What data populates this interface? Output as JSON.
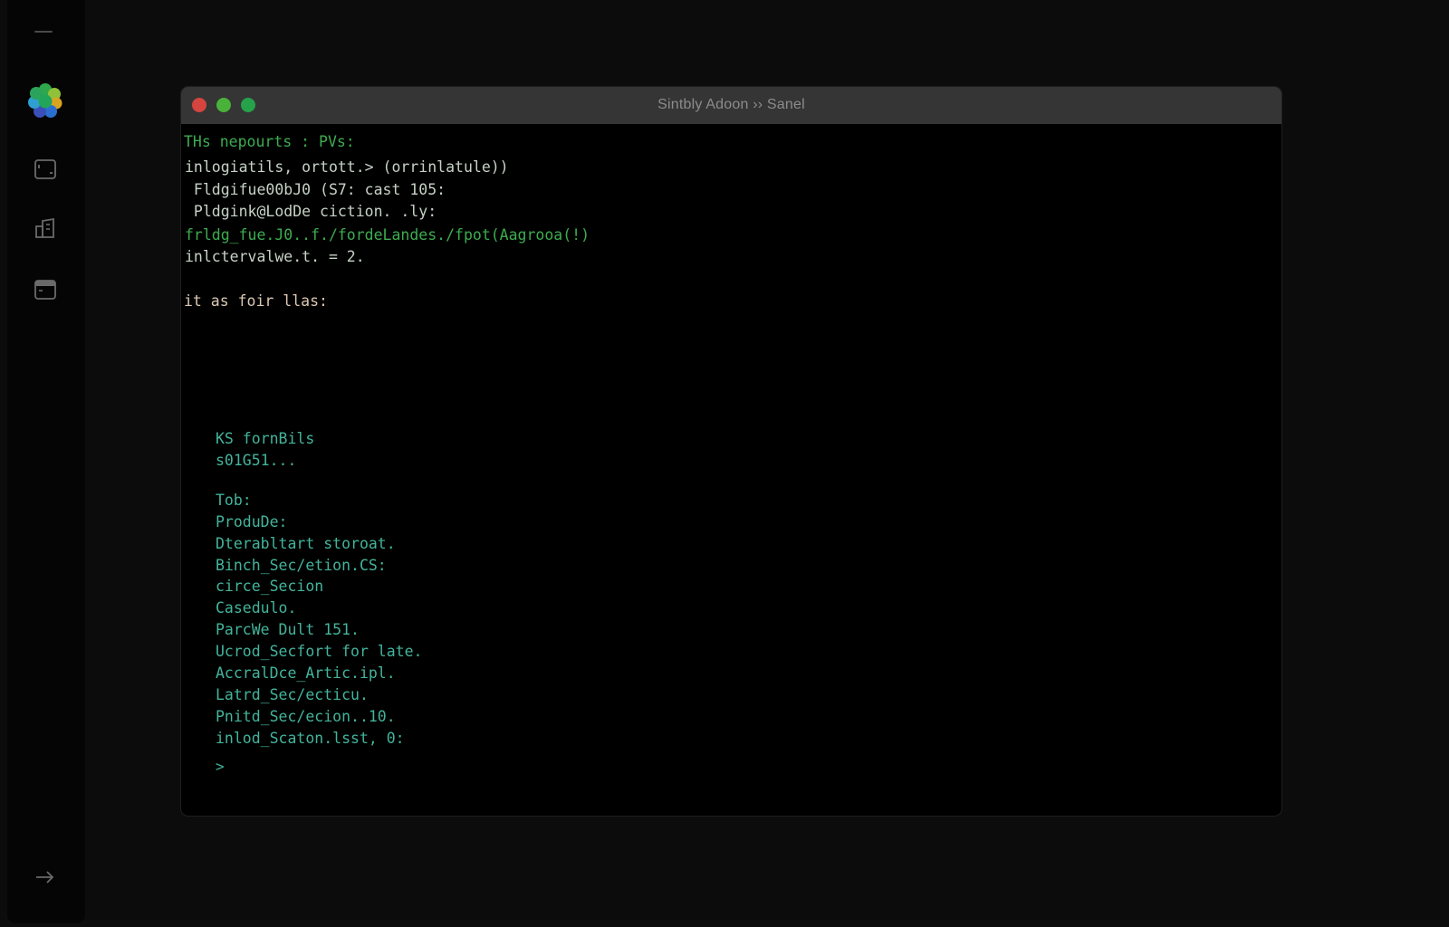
{
  "window": {
    "title": "Sintbly Adoon ›› Sanel"
  },
  "terminal": {
    "header_lines": [
      "THs nepourts : PVs:",
      "inlogiatils, ortott.> (orrinlatule))",
      " Fldgifue00bJ0 (S7: cast 105:",
      " Pldgink@LodDe ciction. .ly:",
      "frldg_fue.J0..f./fordeLandes./fpot(Aagrooa(!)",
      "inlctervalwe.t. = 2.",
      "it as foir llas:"
    ],
    "block_lines": [
      "KS fornBils",
      "s01G51..."
    ],
    "list_lines": [
      "Tob:",
      "ProduDe:",
      "Dterabltart storoat.",
      "Binch_Sec/etion.CS:",
      "circe_Secion",
      "Casedulo.",
      "ParcWe Dult 151.",
      "Ucrod_Secfort for late.",
      "AccralDce_Artic.ipl.",
      "Latrd_Sec/ecticu.",
      "Pnitd_Sec/ecion..10.",
      "inlod_Scaton.lsst, 0:"
    ],
    "prompt_symbol": ">"
  },
  "icons": {
    "sidebar": [
      "minimize-icon",
      "app-logo-icon",
      "terminal-window-icon",
      "buildings-icon",
      "storage-icon",
      "arrow-right-icon"
    ]
  },
  "colors": {
    "background": "#0c0c0c",
    "sidebar": "#050505",
    "titlebar": "#353535",
    "terminal": "#000000",
    "green_text": "#3dac50",
    "teal_text": "#43b49c",
    "close": "#d3453e",
    "minimize": "#49b23a",
    "maximize": "#26a24a"
  }
}
